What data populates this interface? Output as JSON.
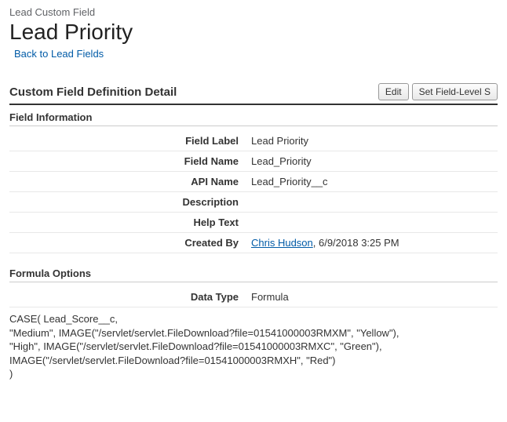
{
  "breadcrumb": "Lead Custom Field",
  "page_title": "Lead Priority",
  "back_link": "Back to Lead Fields",
  "section_header": "Custom Field Definition Detail",
  "buttons": {
    "edit": "Edit",
    "set_fls": "Set Field-Level S"
  },
  "field_info": {
    "heading": "Field Information",
    "labels": {
      "field_label": "Field Label",
      "field_name": "Field Name",
      "api_name": "API Name",
      "description": "Description",
      "help_text": "Help Text",
      "created_by": "Created By"
    },
    "values": {
      "field_label": "Lead Priority",
      "field_name": "Lead_Priority",
      "api_name": "Lead_Priority__c",
      "description": "",
      "help_text": "",
      "created_by_user": "Chris Hudson",
      "created_by_date": ", 6/9/2018 3:25 PM"
    }
  },
  "formula_options": {
    "heading": "Formula Options",
    "labels": {
      "data_type": "Data Type"
    },
    "values": {
      "data_type": "Formula"
    },
    "formula_text": "CASE( Lead_Score__c,\n\"Medium\", IMAGE(\"/servlet/servlet.FileDownload?file=01541000003RMXM\", \"Yellow\"),\n\"High\", IMAGE(\"/servlet/servlet.FileDownload?file=01541000003RMXC\", \"Green\"),\nIMAGE(\"/servlet/servlet.FileDownload?file=01541000003RMXH\", \"Red\")\n)"
  }
}
